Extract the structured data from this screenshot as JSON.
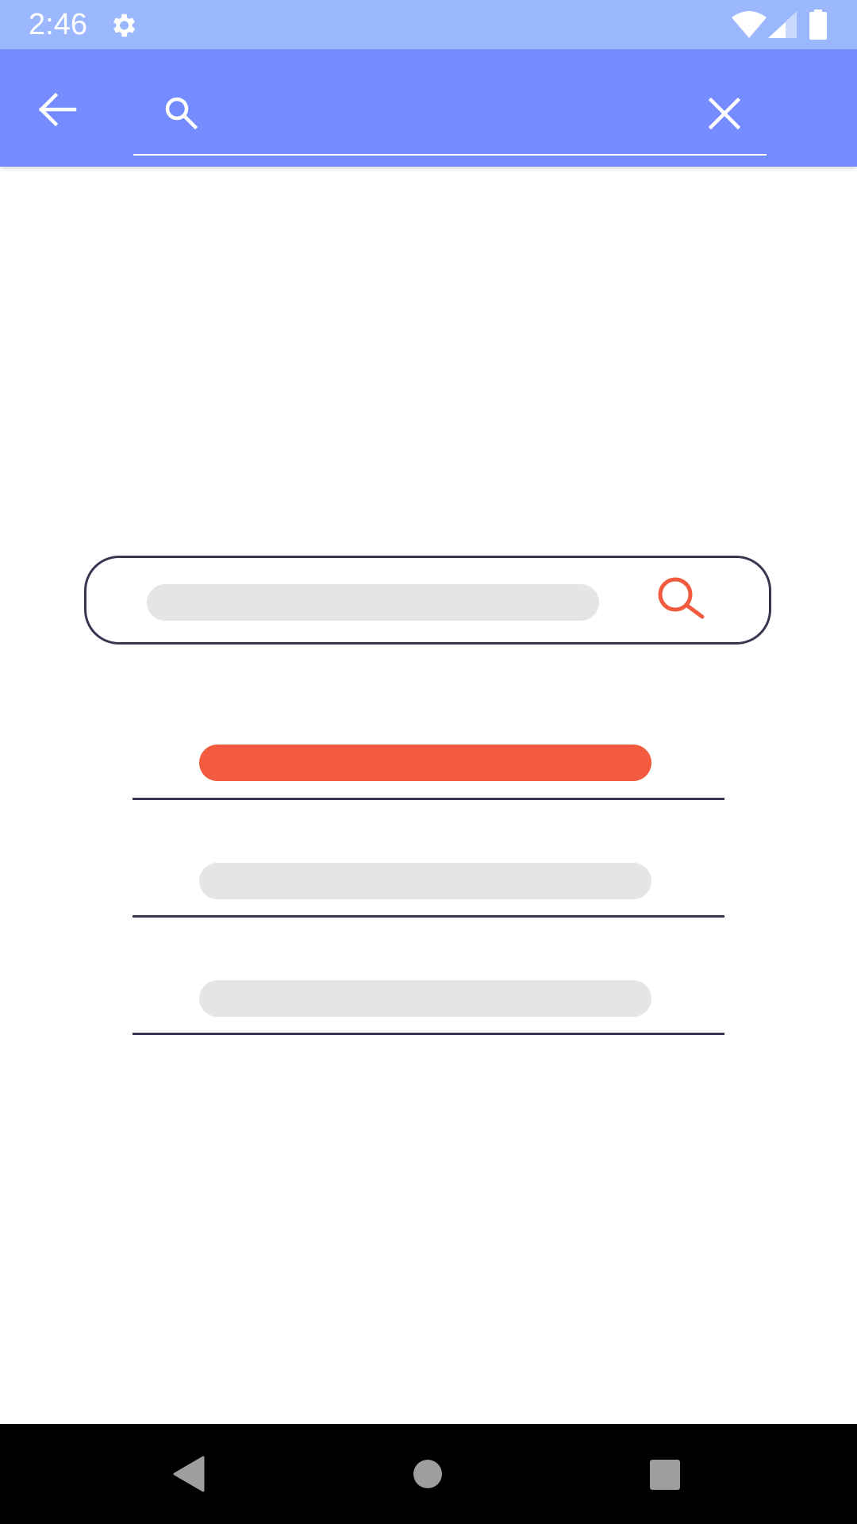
{
  "status_bar": {
    "time": "2:46",
    "icons": [
      "gear-icon",
      "wifi-icon",
      "cellular-signal-icon",
      "battery-icon"
    ]
  },
  "app_bar": {
    "back_icon": "arrow-left-icon",
    "search_icon": "search-icon",
    "search_value": "",
    "search_placeholder": "",
    "clear_icon": "close-icon",
    "background_color": "#748cff"
  },
  "illustration": {
    "search_icon": "search-icon",
    "accent_color": "#f25b3e",
    "results": [
      {
        "state": "active"
      },
      {
        "state": "inactive"
      },
      {
        "state": "inactive"
      }
    ]
  },
  "nav_bar": {
    "icons": [
      "nav-back-icon",
      "nav-home-icon",
      "nav-recents-icon"
    ]
  },
  "colors": {
    "status_bar": "#9bb8ff",
    "app_bar": "#748cff",
    "accent": "#f25b3e",
    "placeholder_gray": "#e5e5e5",
    "outline": "#3a3650"
  }
}
